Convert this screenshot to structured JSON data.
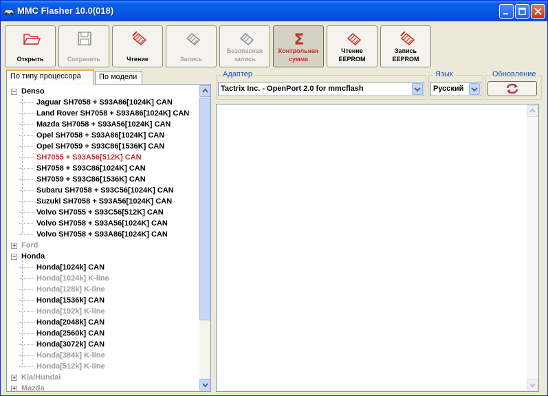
{
  "window": {
    "title": "MMC Flasher 10.0(018)"
  },
  "toolbar": [
    {
      "label": "Открыть",
      "icon": "open-folder-icon",
      "state": "normal"
    },
    {
      "label": "Сохранить",
      "icon": "save-floppy-icon",
      "state": "disabled"
    },
    {
      "label": "Чтение",
      "icon": "read-chip-icon",
      "state": "normal"
    },
    {
      "label": "Запись",
      "icon": "write-chip-icon",
      "state": "disabled"
    },
    {
      "label": "Безопасная запись",
      "icon": "safe-write-chip-icon",
      "state": "disabled"
    },
    {
      "label": "Контрольная сумма",
      "icon": "sigma-icon",
      "state": "pressed"
    },
    {
      "label": "Чтение EEPROM",
      "icon": "read-eeprom-icon",
      "state": "normal"
    },
    {
      "label": "Запись EEPROM",
      "icon": "write-eeprom-icon",
      "state": "normal"
    }
  ],
  "tabs": [
    {
      "label": "По типу процессора",
      "active": true
    },
    {
      "label": "По модели",
      "active": false
    }
  ],
  "tree": [
    {
      "label": "Denso",
      "type": "category",
      "expanded": true,
      "style": "normal"
    },
    {
      "label": "Jaguar SH7058 + S93A86[1024K] CAN",
      "type": "item",
      "style": "normal"
    },
    {
      "label": "Land Rover SH7058 + S93A86[1024K] CAN",
      "type": "item",
      "style": "normal"
    },
    {
      "label": "Mazda SH7058 + S93A56[1024K] CAN",
      "type": "item",
      "style": "normal"
    },
    {
      "label": "Opel SH7058 + S93A86[1024K] CAN",
      "type": "item",
      "style": "normal"
    },
    {
      "label": "Opel SH7059 + S93C86[1536K] CAN",
      "type": "item",
      "style": "normal"
    },
    {
      "label": "SH7055 + S93A56[512K] CAN",
      "type": "item",
      "style": "red"
    },
    {
      "label": "SH7058 + S93C86[1024K] CAN",
      "type": "item",
      "style": "normal"
    },
    {
      "label": "SH7059 + S93C86[1536K] CAN",
      "type": "item",
      "style": "normal"
    },
    {
      "label": "Subaru SH7058 + S93C56[1024K] CAN",
      "type": "item",
      "style": "normal"
    },
    {
      "label": "Suzuki SH7058 + S93A56[1024K] CAN",
      "type": "item",
      "style": "normal"
    },
    {
      "label": "Volvo SH7055 + S93C56[512K] CAN",
      "type": "item",
      "style": "normal"
    },
    {
      "label": "Volvo SH7058 + S93A56[1024K] CAN",
      "type": "item",
      "style": "normal"
    },
    {
      "label": "Volvo SH7058 + S93A86[1024K] CAN",
      "type": "item",
      "style": "normal"
    },
    {
      "label": "Ford",
      "type": "category",
      "expanded": false,
      "style": "dim"
    },
    {
      "label": "Honda",
      "type": "category",
      "expanded": true,
      "style": "normal"
    },
    {
      "label": "Honda[1024k] CAN",
      "type": "item",
      "style": "normal"
    },
    {
      "label": "Honda[1024k] K-line",
      "type": "item",
      "style": "dim"
    },
    {
      "label": "Honda[128k] K-line",
      "type": "item",
      "style": "dim"
    },
    {
      "label": "Honda[1536k] CAN",
      "type": "item",
      "style": "normal"
    },
    {
      "label": "Honda[192k] K-line",
      "type": "item",
      "style": "dim"
    },
    {
      "label": "Honda[2048k] CAN",
      "type": "item",
      "style": "normal"
    },
    {
      "label": "Honda[2560k] CAN",
      "type": "item",
      "style": "normal"
    },
    {
      "label": "Honda[3072k] CAN",
      "type": "item",
      "style": "normal"
    },
    {
      "label": "Honda[384k] K-line",
      "type": "item",
      "style": "dim"
    },
    {
      "label": "Honda[512k] K-line",
      "type": "item",
      "style": "dim"
    },
    {
      "label": "Kia/Hundai",
      "type": "category",
      "expanded": false,
      "style": "dim"
    },
    {
      "label": "Mazda",
      "type": "category",
      "expanded": false,
      "style": "dim"
    }
  ],
  "adapter": {
    "group_label": "Адаптер",
    "value": "Tactrix Inc. - OpenPort 2.0 for mmcflash"
  },
  "language": {
    "group_label": "Язык",
    "value": "Русский"
  },
  "update": {
    "group_label": "Обновление",
    "icon": "refresh-icon"
  },
  "colors": {
    "title_bar": "#0554e0",
    "accent_red": "#c0302a",
    "group_label": "#1f4fc2",
    "dim_text": "#9a9a9a"
  }
}
